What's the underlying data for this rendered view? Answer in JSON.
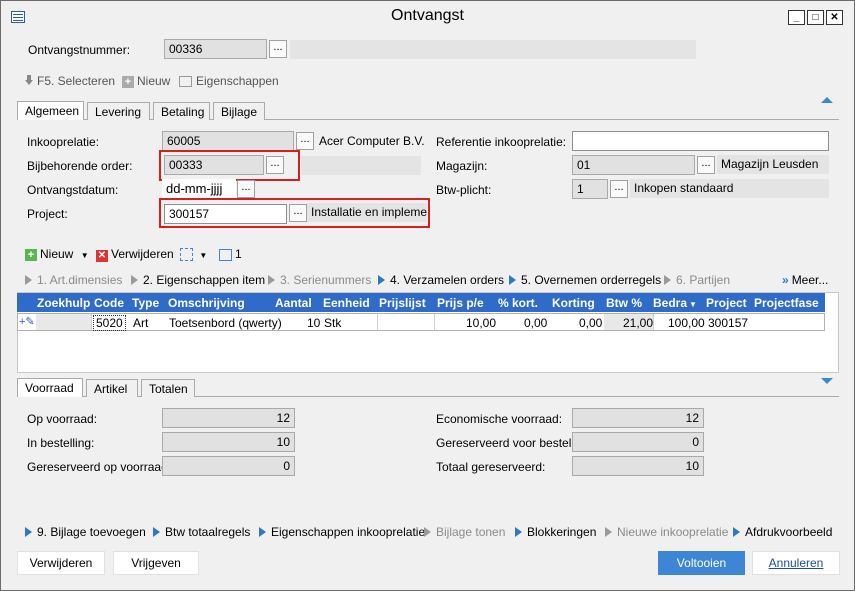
{
  "window": {
    "title": "Ontvangst"
  },
  "header": {
    "ontvangstnummer_label": "Ontvangstnummer:",
    "ontvangstnummer_value": "00336",
    "ellipsis": "..."
  },
  "toolbar": {
    "f5": "F5. Selecteren",
    "nieuw": "Nieuw",
    "eigenschappen": "Eigenschappen"
  },
  "tabs_top": [
    "Algemeen",
    "Levering",
    "Betaling",
    "Bijlage"
  ],
  "form_left": {
    "inkooprelatie_label": "Inkooprelatie:",
    "inkooprelatie_value": "60005",
    "inkooprelatie_desc": "Acer Computer B.V.",
    "order_label": "Bijbehorende order:",
    "order_value": "00333",
    "datum_label": "Ontvangstdatum:",
    "datum_value": "dd-mm-jjjj",
    "project_label": "Project:",
    "project_value": "300157",
    "project_desc": "Installatie en impleme"
  },
  "form_right": {
    "referentie_label": "Referentie inkooprelatie:",
    "referentie_value": "",
    "magazijn_label": "Magazijn:",
    "magazijn_value": "01",
    "magazijn_desc": "Magazijn Leusden",
    "btw_label": "Btw-plicht:",
    "btw_value": "1",
    "btw_desc": "Inkopen standaard"
  },
  "line_toolbar": {
    "nieuw": "Nieuw",
    "verwijderen": "Verwijderen",
    "count": "1"
  },
  "steps": [
    {
      "label": "1. Art.dimensies",
      "enabled": false
    },
    {
      "label": "2. Eigenschappen item",
      "enabled": false
    },
    {
      "label": "3. Serienummers",
      "enabled": false
    },
    {
      "label": "4. Verzamelen orders",
      "enabled": true
    },
    {
      "label": "5. Overnemen orderregels",
      "enabled": true
    },
    {
      "label": "6. Partijen",
      "enabled": false
    },
    {
      "label": "Meer...",
      "enabled": true
    }
  ],
  "grid": {
    "columns": [
      "Zoekhulp",
      "Code",
      "Type",
      "Omschrijving",
      "Aantal",
      "Eenheid",
      "Prijslijst",
      "Prijs p/e",
      "% kort.",
      "Korting",
      "Btw %",
      "Bedra",
      "Project",
      "Projectfase"
    ],
    "row": {
      "code": "5020",
      "type": "Art",
      "omschrijving": "Toetsenbord (qwerty)",
      "aantal": "10",
      "eenheid": "Stk",
      "prijslijst": "",
      "prijs": "10,00",
      "kort": "0,00",
      "korting": "0,00",
      "btw": "21,00",
      "bedrag": "100,00",
      "project": "300157",
      "projectfase": ""
    }
  },
  "tabs_bottom": [
    "Voorraad",
    "Artikel",
    "Totalen"
  ],
  "stock_left": {
    "op_voorraad_label": "Op voorraad:",
    "op_voorraad": "12",
    "in_bestelling_label": "In bestelling:",
    "in_bestelling": "10",
    "gereserveerd_label": "Gereserveerd op voorraad:",
    "gereserveerd": "0"
  },
  "stock_right": {
    "economisch_label": "Economische voorraad:",
    "economisch": "12",
    "gereserveerd_best_label": "Gereserveerd voor bestelling",
    "gereserveerd_best": "0",
    "totaal_label": "Totaal gereserveerd:",
    "totaal": "10"
  },
  "actions": [
    {
      "label": "9. Bijlage toevoegen",
      "enabled": true
    },
    {
      "label": "Btw totaalregels",
      "enabled": true
    },
    {
      "label": "Eigenschappen inkooprelatie",
      "enabled": true
    },
    {
      "label": "Bijlage tonen",
      "enabled": false
    },
    {
      "label": "Blokkeringen",
      "enabled": true
    },
    {
      "label": "Nieuwe inkooprelatie",
      "enabled": false
    },
    {
      "label": "Afdrukvoorbeeld",
      "enabled": true
    }
  ],
  "buttons": {
    "verwijderen": "Verwijderen",
    "vrijgeven": "Vrijgeven",
    "voltooien": "Voltooien",
    "annuleren": "Annuleren"
  },
  "colors": {
    "accent": "#3c86d5",
    "grid_header": "#2f6bc9",
    "highlight": "#d62020"
  }
}
